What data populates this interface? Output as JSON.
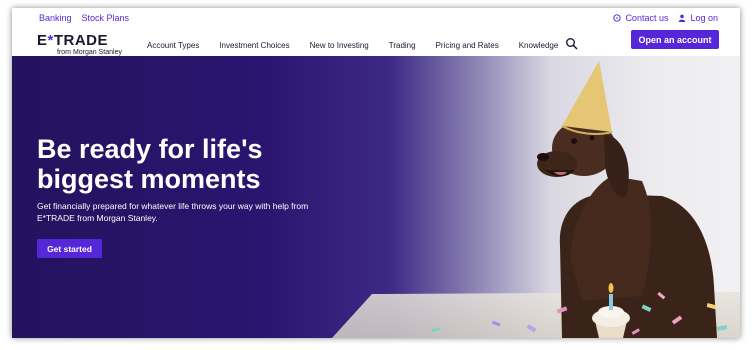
{
  "utility": {
    "links": [
      "Banking",
      "Stock Plans"
    ],
    "contact": "Contact us",
    "login": "Log on"
  },
  "logo": {
    "text_left": "E",
    "star": "*",
    "text_right": "TRADE",
    "subtitle": "from Morgan Stanley"
  },
  "nav": {
    "items": [
      "Account Types",
      "Investment Choices",
      "New to Investing",
      "Trading",
      "Pricing and Rates",
      "Knowledge"
    ],
    "search_icon": "search-icon",
    "cta": "Open an account"
  },
  "hero": {
    "title_line1": "Be ready for life's",
    "title_line2": "biggest moments",
    "subtitle": "Get financially prepared for whatever life throws your way with help from E*TRADE from Morgan Stanley.",
    "button": "Get started"
  },
  "colors": {
    "accent": "#5627d8",
    "hero_dark": "#24125e",
    "text_dark": "#1a1a2e"
  }
}
